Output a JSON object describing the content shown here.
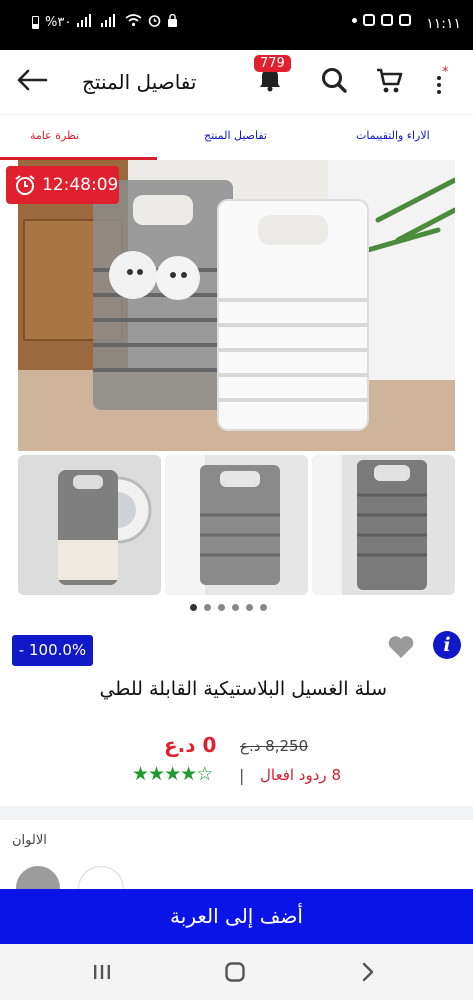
{
  "status_bar": {
    "time": "١١:١١",
    "battery": "%٣٠"
  },
  "app_bar": {
    "title": "تفاصيل المنتج",
    "notification_count": "779"
  },
  "tabs": [
    {
      "label": "نظرة عامة",
      "active": true
    },
    {
      "label": "تفاصيل المنتج",
      "active": false
    },
    {
      "label": "الاراء والتقييمات",
      "active": false
    }
  ],
  "timer": "12:48:09",
  "gallery": {
    "thumbnail_count": 3,
    "dot_count": 6,
    "active_dot": 0
  },
  "product": {
    "discount": "- 100.0%",
    "name": "سلة الغسيل البلاستيكية القابلة للطي",
    "price": "0 د.ع",
    "old_price": "8,250 د.ع",
    "rating": 4,
    "rating_max": 5,
    "reactions": "8 ردود افعال"
  },
  "colors": {
    "label": "الالوان",
    "options": [
      "#9c9c9c",
      "#ffffff"
    ]
  },
  "cta": {
    "label": "أضف إلى العربة"
  },
  "theme": {
    "accent": "#0a14e6",
    "badge": "#e0202e",
    "stars": "#1f9a2f"
  }
}
